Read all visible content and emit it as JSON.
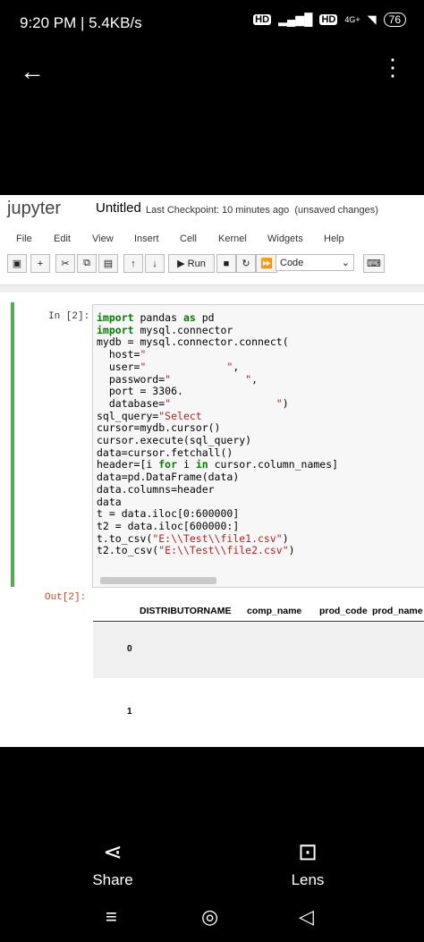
{
  "status": {
    "time": "9:20 PM | 5.4KB/s",
    "signal1": "HD",
    "signal2": "HD",
    "net": "4G+",
    "battery": "76"
  },
  "viewer": {
    "share_label": "Share",
    "lens_label": "Lens"
  },
  "jupyter": {
    "logo": "jupyter",
    "title": "Untitled",
    "checkpoint": "Last Checkpoint: 10 minutes ago",
    "unsaved": "(unsaved changes)",
    "menu": [
      "File",
      "Edit",
      "View",
      "Insert",
      "Cell",
      "Kernel",
      "Widgets",
      "Help"
    ],
    "toolbar": {
      "run": "Run",
      "cell_type": "Code"
    },
    "cell": {
      "in_prompt": "In [2]:",
      "out_prompt": "Out[2]:",
      "code_lines": [
        "import pandas as pd",
        "import mysql.connector",
        "mydb = mysql.connector.connect(",
        "  host=\"",
        "  user=\"             \",",
        "  password=\"            \",",
        "  port = 3306.",
        "  database=\"                 \")",
        "sql_query=\"Select",
        "cursor=mydb.cursor()",
        "cursor.execute(sql_query)",
        "data=cursor.fetchall()",
        "header=[i for i in cursor.column_names]",
        "data=pd.DataFrame(data)",
        "data.columns=header",
        "data",
        "t = data.iloc[0:600000]",
        "t2 = data.iloc[600000:]",
        "t.to_csv(\"E:\\\\Test\\\\file1.csv\")",
        "t2.to_csv(\"E:\\\\Test\\\\file2.csv\")"
      ]
    },
    "output_table": {
      "columns": [
        "DISTRIBUTORNAME",
        "comp_name",
        "prod_code",
        "prod_name"
      ],
      "row_index": [
        "0",
        "1"
      ]
    }
  }
}
